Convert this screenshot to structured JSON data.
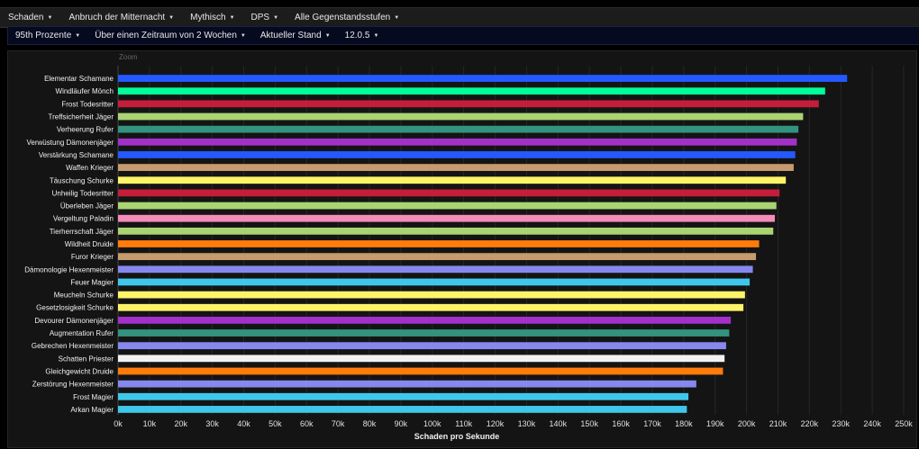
{
  "nav_primary": [
    {
      "label": "Schaden",
      "name": "dropdown-metric"
    },
    {
      "label": "Anbruch der Mitternacht",
      "name": "dropdown-expansion"
    },
    {
      "label": "Mythisch",
      "name": "dropdown-difficulty"
    },
    {
      "label": "DPS",
      "name": "dropdown-role"
    },
    {
      "label": "Alle Gegenstandsstufen",
      "name": "dropdown-item-level"
    }
  ],
  "nav_secondary": [
    {
      "label": "95th Prozente",
      "name": "dropdown-percentile"
    },
    {
      "label": "Über einen Zeitraum von 2 Wochen",
      "name": "dropdown-timeframe"
    },
    {
      "label": "Aktueller Stand",
      "name": "dropdown-state"
    },
    {
      "label": "12.0.5",
      "name": "dropdown-patch"
    }
  ],
  "chart_data": {
    "type": "bar",
    "orientation": "horizontal",
    "corner_label": "Zoom",
    "xlabel": "Schaden pro Sekunde",
    "xlim": [
      0,
      250000
    ],
    "x_ticks": [
      "0k",
      "10k",
      "20k",
      "30k",
      "40k",
      "50k",
      "60k",
      "70k",
      "80k",
      "90k",
      "100k",
      "110k",
      "120k",
      "130k",
      "140k",
      "150k",
      "160k",
      "170k",
      "180k",
      "190k",
      "200k",
      "210k",
      "220k",
      "230k",
      "240k",
      "250k"
    ],
    "grid": true,
    "categories": [
      "Elementar Schamane",
      "Windläufer Mönch",
      "Frost Todesritter",
      "Treffsicherheit Jäger",
      "Verheerung Rufer",
      "Verwüstung Dämonenjäger",
      "Verstärkung Schamane",
      "Waffen Krieger",
      "Täuschung Schurke",
      "Unheilig Todesritter",
      "Überleben Jäger",
      "Vergeltung Paladin",
      "Tierherrschaft Jäger",
      "Wildheit Druide",
      "Furor Krieger",
      "Dämonologie Hexenmeister",
      "Feuer Magier",
      "Meucheln Schurke",
      "Gesetzlosigkeit Schurke",
      "Devourer Dämonenjäger",
      "Augmentation Rufer",
      "Gebrechen Hexenmeister",
      "Schatten Priester",
      "Gleichgewicht Druide",
      "Zerstörung Hexenmeister",
      "Frost Magier",
      "Arkan Magier"
    ],
    "values": [
      232000,
      225000,
      223000,
      218000,
      216500,
      216000,
      215500,
      215000,
      212500,
      210500,
      209500,
      209000,
      208500,
      204000,
      203000,
      202000,
      201000,
      199500,
      199000,
      195000,
      194500,
      193500,
      193000,
      192500,
      184000,
      181500,
      181000
    ],
    "colors": [
      "#2459ff",
      "#00ff98",
      "#c41e3a",
      "#aad372",
      "#33937f",
      "#a330c9",
      "#2459ff",
      "#c69b6d",
      "#fff468",
      "#c41e3a",
      "#aad372",
      "#f48cba",
      "#aad372",
      "#ff7c0a",
      "#c69b6d",
      "#8788ee",
      "#3fc7eb",
      "#fff468",
      "#fff468",
      "#a330c9",
      "#33937f",
      "#8788ee",
      "#f2f2f2",
      "#ff7c0a",
      "#8788ee",
      "#3fc7eb",
      "#3fc7eb"
    ]
  }
}
